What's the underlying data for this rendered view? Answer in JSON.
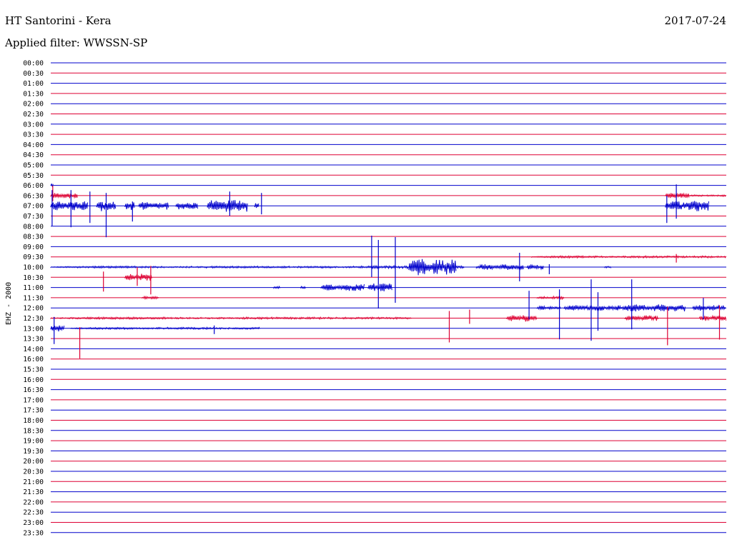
{
  "header": {
    "station": "HT Santorini - Kera",
    "date": "2017-07-24",
    "filter": "Applied filter: WWSSN-SP"
  },
  "chart_data": {
    "type": "line",
    "title": "HT Santorini - Kera",
    "channel_label": "EHZ - 2000",
    "row_labels": [
      "00:00",
      "00:30",
      "01:00",
      "01:30",
      "02:00",
      "02:30",
      "03:00",
      "03:30",
      "04:00",
      "04:30",
      "05:00",
      "05:30",
      "06:00",
      "06:30",
      "07:00",
      "07:30",
      "08:00",
      "08:30",
      "09:00",
      "09:30",
      "10:00",
      "10:30",
      "11:00",
      "11:30",
      "12:00",
      "12:30",
      "13:00",
      "13:30",
      "14:00",
      "16:00",
      "15:30",
      "16:00",
      "16:30",
      "17:00",
      "17:30",
      "18:00",
      "18:30",
      "19:00",
      "19:30",
      "20:00",
      "20:30",
      "21:00",
      "21:30",
      "22:00",
      "22:30",
      "23:00",
      "23:30"
    ],
    "colors": {
      "even": "#0000cc",
      "odd": "#dd0033"
    },
    "bursts": [
      {
        "row": 12,
        "x0": 0.0,
        "x1": 0.004,
        "amp": 2
      },
      {
        "row": 13,
        "x0": 0.0,
        "x1": 0.04,
        "amp": 4
      },
      {
        "row": 13,
        "x0": 0.91,
        "x1": 0.945,
        "amp": 4
      },
      {
        "row": 13,
        "x0": 0.945,
        "x1": 1.0,
        "amp": 1.2
      },
      {
        "row": 14,
        "x0": 0.0,
        "x1": 0.055,
        "amp": 7
      },
      {
        "row": 14,
        "x0": 0.068,
        "x1": 0.096,
        "amp": 8
      },
      {
        "row": 14,
        "x0": 0.11,
        "x1": 0.125,
        "amp": 6
      },
      {
        "row": 14,
        "x0": 0.13,
        "x1": 0.175,
        "amp": 6
      },
      {
        "row": 14,
        "x0": 0.185,
        "x1": 0.218,
        "amp": 6
      },
      {
        "row": 14,
        "x0": 0.232,
        "x1": 0.292,
        "amp": 9
      },
      {
        "row": 14,
        "x0": 0.302,
        "x1": 0.308,
        "amp": 6
      },
      {
        "row": 14,
        "x0": 0.91,
        "x1": 0.975,
        "amp": 8
      },
      {
        "row": 19,
        "x0": 0.712,
        "x1": 1.0,
        "amp": 1.5
      },
      {
        "row": 20,
        "x0": 0.0,
        "x1": 0.465,
        "amp": 1.4
      },
      {
        "row": 20,
        "x0": 0.465,
        "x1": 0.53,
        "amp": 2
      },
      {
        "row": 20,
        "x0": 0.53,
        "x1": 0.6,
        "amp": 12
      },
      {
        "row": 20,
        "x0": 0.6,
        "x1": 0.612,
        "amp": 2
      },
      {
        "row": 20,
        "x0": 0.63,
        "x1": 0.7,
        "amp": 4
      },
      {
        "row": 20,
        "x0": 0.705,
        "x1": 0.73,
        "amp": 4
      },
      {
        "row": 20,
        "x0": 0.82,
        "x1": 0.83,
        "amp": 2
      },
      {
        "row": 21,
        "x0": 0.11,
        "x1": 0.15,
        "amp": 5
      },
      {
        "row": 22,
        "x0": 0.33,
        "x1": 0.34,
        "amp": 2
      },
      {
        "row": 22,
        "x0": 0.37,
        "x1": 0.378,
        "amp": 2
      },
      {
        "row": 22,
        "x0": 0.4,
        "x1": 0.465,
        "amp": 5
      },
      {
        "row": 22,
        "x0": 0.47,
        "x1": 0.505,
        "amp": 6
      },
      {
        "row": 23,
        "x0": 0.135,
        "x1": 0.16,
        "amp": 2
      },
      {
        "row": 23,
        "x0": 0.72,
        "x1": 0.76,
        "amp": 2
      },
      {
        "row": 24,
        "x0": 0.72,
        "x1": 0.755,
        "amp": 3
      },
      {
        "row": 24,
        "x0": 0.76,
        "x1": 0.845,
        "amp": 4
      },
      {
        "row": 24,
        "x0": 0.845,
        "x1": 0.94,
        "amp": 5
      },
      {
        "row": 24,
        "x0": 0.95,
        "x1": 1.0,
        "amp": 4
      },
      {
        "row": 25,
        "x0": 0.0,
        "x1": 0.535,
        "amp": 1.5
      },
      {
        "row": 25,
        "x0": 0.675,
        "x1": 0.72,
        "amp": 5
      },
      {
        "row": 25,
        "x0": 0.85,
        "x1": 0.9,
        "amp": 4
      },
      {
        "row": 25,
        "x0": 0.96,
        "x1": 1.0,
        "amp": 4
      },
      {
        "row": 26,
        "x0": 0.0,
        "x1": 0.02,
        "amp": 5
      },
      {
        "row": 26,
        "x0": 0.03,
        "x1": 0.31,
        "amp": 1.4
      }
    ],
    "spikes": [
      {
        "row": 13,
        "x": 0.003,
        "up": 14,
        "down": 8
      },
      {
        "row": 14,
        "x": 0.002,
        "up": 22,
        "down": 28
      },
      {
        "row": 14,
        "x": 0.03,
        "up": 22,
        "down": 30
      },
      {
        "row": 14,
        "x": 0.058,
        "up": 20,
        "down": 24
      },
      {
        "row": 14,
        "x": 0.082,
        "up": 18,
        "down": 44
      },
      {
        "row": 14,
        "x": 0.121,
        "up": 6,
        "down": 22
      },
      {
        "row": 14,
        "x": 0.265,
        "up": 20,
        "down": 14
      },
      {
        "row": 14,
        "x": 0.312,
        "up": 18,
        "down": 12
      },
      {
        "row": 14,
        "x": 0.912,
        "up": 14,
        "down": 24
      },
      {
        "row": 14,
        "x": 0.926,
        "up": 30,
        "down": 18
      },
      {
        "row": 19,
        "x": 0.926,
        "up": 4,
        "down": 8
      },
      {
        "row": 20,
        "x": 0.475,
        "up": 44,
        "down": 14
      },
      {
        "row": 20,
        "x": 0.485,
        "up": 38,
        "down": 58
      },
      {
        "row": 20,
        "x": 0.51,
        "up": 42,
        "down": 50
      },
      {
        "row": 20,
        "x": 0.694,
        "up": 20,
        "down": 20
      },
      {
        "row": 20,
        "x": 0.738,
        "up": 4,
        "down": 10
      },
      {
        "row": 21,
        "x": 0.078,
        "up": 8,
        "down": 20
      },
      {
        "row": 21,
        "x": 0.128,
        "up": 14,
        "down": 12
      },
      {
        "row": 21,
        "x": 0.148,
        "up": 16,
        "down": 24
      },
      {
        "row": 24,
        "x": 0.708,
        "up": 24,
        "down": 16
      },
      {
        "row": 24,
        "x": 0.753,
        "up": 26,
        "down": 44
      },
      {
        "row": 24,
        "x": 0.8,
        "up": 40,
        "down": 46
      },
      {
        "row": 24,
        "x": 0.81,
        "up": 22,
        "down": 32
      },
      {
        "row": 24,
        "x": 0.86,
        "up": 40,
        "down": 30
      },
      {
        "row": 24,
        "x": 0.966,
        "up": 14,
        "down": 16
      },
      {
        "row": 25,
        "x": 0.59,
        "up": 10,
        "down": 34
      },
      {
        "row": 25,
        "x": 0.62,
        "up": 12,
        "down": 8
      },
      {
        "row": 25,
        "x": 0.913,
        "up": 16,
        "down": 38
      },
      {
        "row": 25,
        "x": 0.99,
        "up": 18,
        "down": 30
      },
      {
        "row": 27,
        "x": 0.043,
        "up": 16,
        "down": 28
      },
      {
        "row": 26,
        "x": 0.005,
        "up": 16,
        "down": 22
      },
      {
        "row": 26,
        "x": 0.242,
        "up": 4,
        "down": 8
      }
    ]
  }
}
